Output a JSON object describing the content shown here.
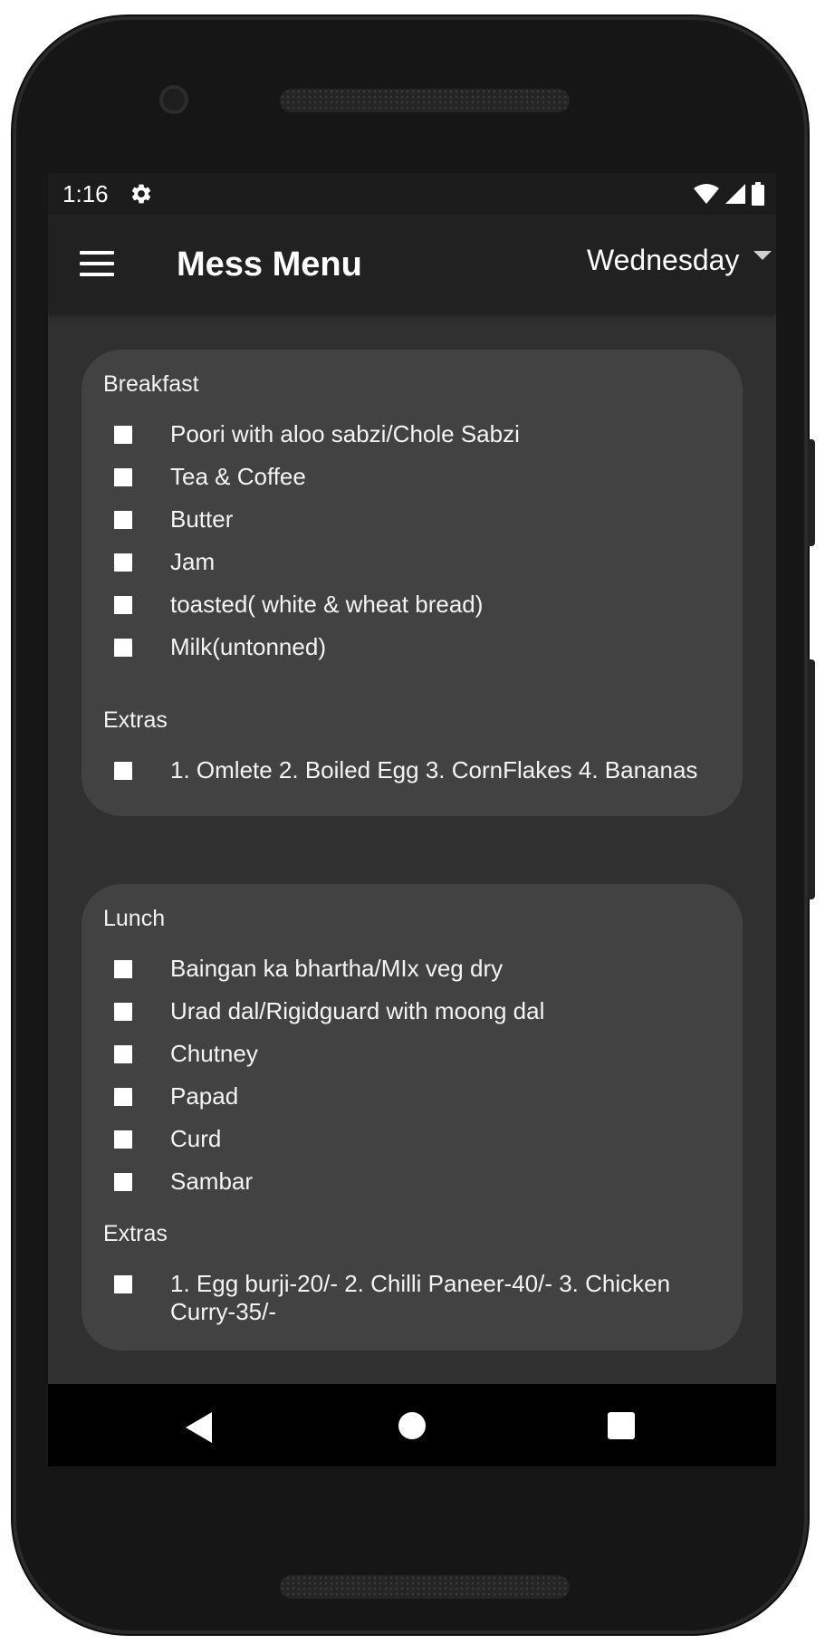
{
  "status_bar": {
    "time": "1:16",
    "icons": [
      "settings-gear-icon",
      "wifi-icon",
      "cell-signal-icon",
      "battery-icon"
    ]
  },
  "app_bar": {
    "title": "Mess Menu",
    "selected_day": "Wednesday",
    "menu_icon": "hamburger-menu-icon",
    "dropdown_icon": "arrow-drop-down-icon"
  },
  "meals": {
    "breakfast": {
      "title": "Breakfast",
      "items": [
        "Poori with aloo sabzi/Chole Sabzi",
        "Tea & Coffee",
        "Butter",
        "Jam",
        "toasted( white & wheat bread)",
        "Milk(untonned)"
      ],
      "extras_title": "Extras",
      "extras": [
        "1. Omlete 2. Boiled Egg 3. CornFlakes 4. Bananas"
      ]
    },
    "lunch": {
      "title": "Lunch",
      "items": [
        "Baingan ka bhartha/MIx veg dry",
        "Urad dal/Rigidguard with moong dal",
        "Chutney",
        "Papad",
        "Curd",
        "Sambar"
      ],
      "extras_title": "Extras",
      "extras": [
        "1. Egg burji-20/- 2. Chilli Paneer-40/- 3. Chicken Curry-35/-"
      ]
    }
  },
  "nav_bar": {
    "icons": [
      "back-triangle-icon",
      "home-circle-icon",
      "recents-square-icon"
    ]
  },
  "colors": {
    "screen_bg": "#303030",
    "card_bg": "#424242",
    "app_bar_bg": "#212121",
    "status_bar_bg": "#1c1c1c",
    "text": "#ffffff"
  }
}
